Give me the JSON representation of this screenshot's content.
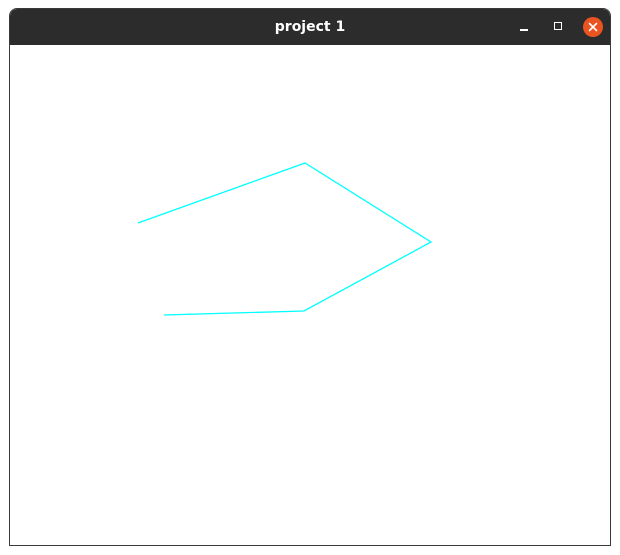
{
  "window": {
    "title": "project 1",
    "titlebar_color": "#2c2c2c",
    "close_button_color": "#e95420"
  },
  "controls": {
    "minimize_icon": "minimize-icon",
    "maximize_icon": "maximize-icon",
    "close_icon": "close-icon"
  },
  "drawing": {
    "stroke_color": "#00ffff",
    "shape": "open polyline"
  }
}
